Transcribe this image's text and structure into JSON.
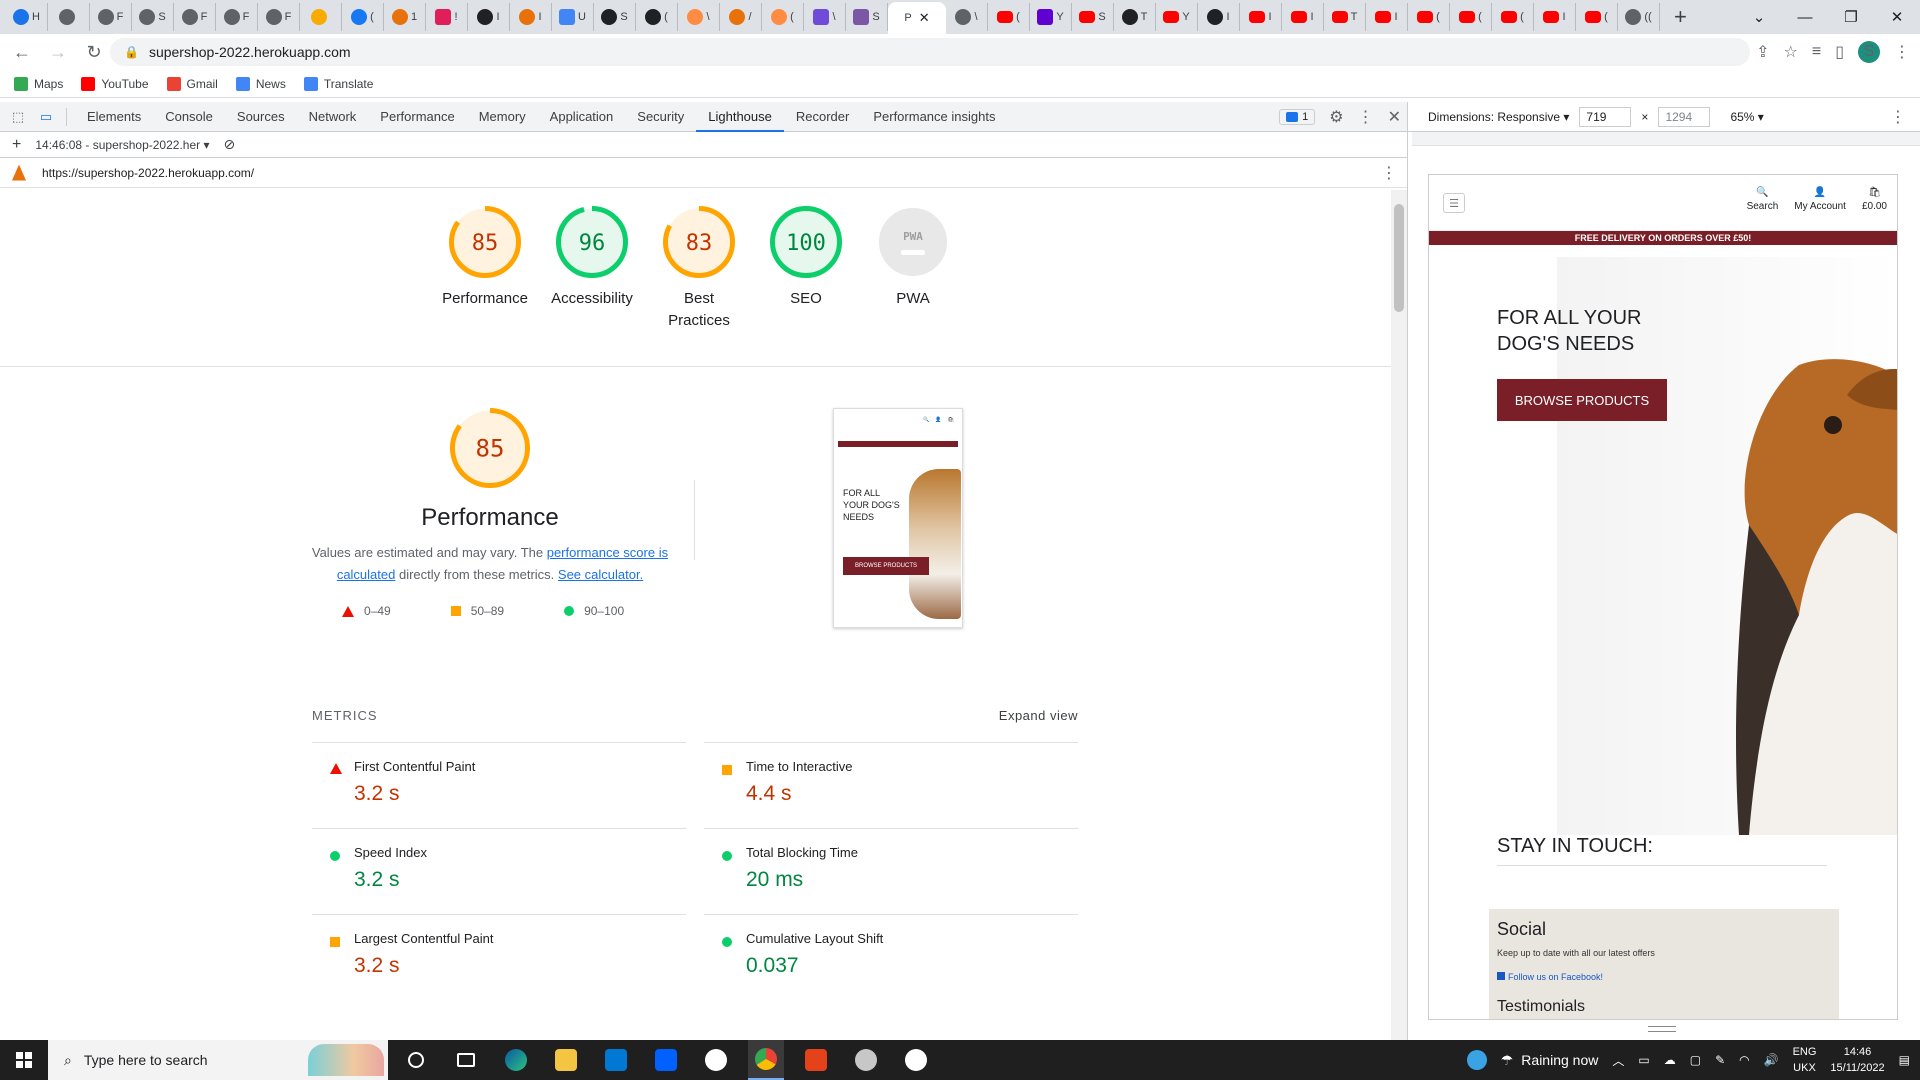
{
  "browser": {
    "url": "supershop-2022.herokuapp.com",
    "tabs": [
      {
        "icon": "history-icon",
        "color": "#1a73e8",
        "label": "H"
      },
      {
        "icon": "circle-icon",
        "color": "#5f6368",
        "label": ""
      },
      {
        "icon": "chrome-icon",
        "color": "#5f6368",
        "label": "F"
      },
      {
        "icon": "chrome-icon",
        "color": "#5f6368",
        "label": "S"
      },
      {
        "icon": "chrome-icon",
        "color": "#5f6368",
        "label": "F"
      },
      {
        "icon": "chrome-icon",
        "color": "#5f6368",
        "label": "F"
      },
      {
        "icon": "chrome-icon",
        "color": "#5f6368",
        "label": "F"
      },
      {
        "icon": "dot-icon",
        "color": "#f9ab00",
        "label": ""
      },
      {
        "icon": "facebook-icon",
        "color": "#1877f2",
        "label": "("
      },
      {
        "icon": "circle-icon",
        "color": "#e8710a",
        "label": "1"
      },
      {
        "icon": "slack-icon",
        "color": "#e01e5a",
        "label": "!"
      },
      {
        "icon": "smile-icon",
        "color": "#202124",
        "label": "I"
      },
      {
        "icon": "circle-icon",
        "color": "#e8710a",
        "label": "I"
      },
      {
        "icon": "docs-icon",
        "color": "#4285f4",
        "label": "U"
      },
      {
        "icon": "github-icon",
        "color": "#202124",
        "label": "S"
      },
      {
        "icon": "github-icon",
        "color": "#202124",
        "label": "("
      },
      {
        "icon": "g-icon",
        "color": "#ff8c42",
        "label": "\\"
      },
      {
        "icon": "circle-icon",
        "color": "#e8710a",
        "label": "/"
      },
      {
        "icon": "g-icon",
        "color": "#ff8c42",
        "label": "("
      },
      {
        "icon": "s-icon",
        "color": "#6e4cd8",
        "label": "\\"
      },
      {
        "icon": "h-icon",
        "color": "#7b57a6",
        "label": "S"
      },
      {
        "icon": "chrome-icon",
        "color": "#5f6368",
        "label": "\\"
      },
      {
        "icon": "youtube-icon",
        "color": "#ff0000",
        "label": "("
      },
      {
        "icon": "yahoo-icon",
        "color": "#6001d2",
        "label": "Y"
      },
      {
        "icon": "youtube-icon",
        "color": "#ff0000",
        "label": "S"
      },
      {
        "icon": "github-icon",
        "color": "#202124",
        "label": "T"
      },
      {
        "icon": "youtube-icon",
        "color": "#ff0000",
        "label": "Y"
      },
      {
        "icon": "github-icon",
        "color": "#202124",
        "label": "I"
      },
      {
        "icon": "youtube-icon",
        "color": "#ff0000",
        "label": "I"
      },
      {
        "icon": "youtube-icon",
        "color": "#ff0000",
        "label": "I"
      },
      {
        "icon": "youtube-icon",
        "color": "#ff0000",
        "label": "T"
      },
      {
        "icon": "youtube-icon",
        "color": "#ff0000",
        "label": "I"
      },
      {
        "icon": "youtube-icon",
        "color": "#ff0000",
        "label": "("
      },
      {
        "icon": "youtube-icon",
        "color": "#ff0000",
        "label": "("
      },
      {
        "icon": "youtube-icon",
        "color": "#ff0000",
        "label": "("
      },
      {
        "icon": "youtube-icon",
        "color": "#ff0000",
        "label": "I"
      },
      {
        "icon": "youtube-icon",
        "color": "#ff0000",
        "label": "("
      },
      {
        "icon": "audio-icon",
        "color": "#5f6368",
        "label": "(("
      }
    ],
    "active_tab": {
      "label": "P",
      "icon": "lighthouse-icon"
    },
    "bookmarks": [
      {
        "label": "Maps",
        "icon": "maps-icon",
        "color": "#34a853"
      },
      {
        "label": "YouTube",
        "icon": "youtube-icon",
        "color": "#ff0000"
      },
      {
        "label": "Gmail",
        "icon": "gmail-icon",
        "color": "#ea4335"
      },
      {
        "label": "News",
        "icon": "news-icon",
        "color": "#4285f4"
      },
      {
        "label": "Translate",
        "icon": "translate-icon",
        "color": "#4285f4"
      }
    ],
    "profile_initial": "S"
  },
  "devtools": {
    "tabs": [
      "Elements",
      "Console",
      "Sources",
      "Network",
      "Performance",
      "Memory",
      "Application",
      "Security",
      "Lighthouse",
      "Recorder",
      "Performance insights"
    ],
    "active_tab": "Lighthouse",
    "issues_count": "1",
    "report_label": "14:46:08 - supershop-2022.her",
    "audited_url": "https://supershop-2022.herokuapp.com/"
  },
  "lighthouse": {
    "gauges": [
      {
        "score": "85",
        "label": "Performance",
        "color": "#ffa400",
        "text_color": "#c33300",
        "fraction": 0.85
      },
      {
        "score": "96",
        "label": "Accessibility",
        "color": "#0cce6b",
        "text_color": "#018642",
        "fraction": 0.96
      },
      {
        "score": "83",
        "label": "Best Practices",
        "color": "#ffa400",
        "text_color": "#c33300",
        "fraction": 0.83
      },
      {
        "score": "100",
        "label": "SEO",
        "color": "#0cce6b",
        "text_color": "#018642",
        "fraction": 1.0
      },
      {
        "score": "PWA",
        "label": "PWA",
        "color": "#c8c8c8",
        "text_color": "#9e9e9e",
        "fraction": 0
      }
    ],
    "performance": {
      "score": "85",
      "fraction": 0.85,
      "title": "Performance",
      "desc_prefix": "Values are estimated and may vary. The ",
      "desc_link1": "performance score is calculated",
      "desc_middle": " directly from these metrics. ",
      "desc_link2": "See calculator."
    },
    "legend": [
      "0–49",
      "50–89",
      "90–100"
    ],
    "metrics_title": "METRICS",
    "expand_label": "Expand view",
    "metrics": [
      {
        "name": "First Contentful Paint",
        "value": "3.2 s",
        "rating": "fail"
      },
      {
        "name": "Time to Interactive",
        "value": "4.4 s",
        "rating": "average"
      },
      {
        "name": "Speed Index",
        "value": "3.2 s",
        "rating": "pass"
      },
      {
        "name": "Total Blocking Time",
        "value": "20 ms",
        "rating": "pass"
      },
      {
        "name": "Largest Contentful Paint",
        "value": "3.2 s",
        "rating": "average"
      },
      {
        "name": "Cumulative Layout Shift",
        "value": "0.037",
        "rating": "pass"
      }
    ],
    "thumb": {
      "headline": "FOR ALL YOUR DOG'S NEEDS",
      "button": "BROWSE PRODUCTS"
    }
  },
  "device": {
    "dimensions_label": "Dimensions: Responsive",
    "width": "719",
    "height_placeholder": "1294",
    "zoom": "65%"
  },
  "site": {
    "icons": [
      {
        "label": "Search",
        "icon": "search-icon"
      },
      {
        "label": "My Account",
        "icon": "user-icon"
      },
      {
        "label": "£0.00",
        "icon": "bag-icon"
      }
    ],
    "banner": "FREE DELIVERY ON ORDERS OVER £50!",
    "headline": "FOR ALL YOUR DOG'S NEEDS",
    "cta": "BROWSE PRODUCTS",
    "stay_title": "STAY IN TOUCH:",
    "social_title": "Social",
    "social_desc": "Keep up to date with all our latest offers",
    "social_link": "Follow us on Facebook!",
    "next_title": "Testimonials"
  },
  "taskbar": {
    "search_placeholder": "Type here to search",
    "weather": "Raining now",
    "lang_top": "ENG",
    "lang_bottom": "UKX",
    "time": "14:46",
    "date": "15/11/2022"
  }
}
